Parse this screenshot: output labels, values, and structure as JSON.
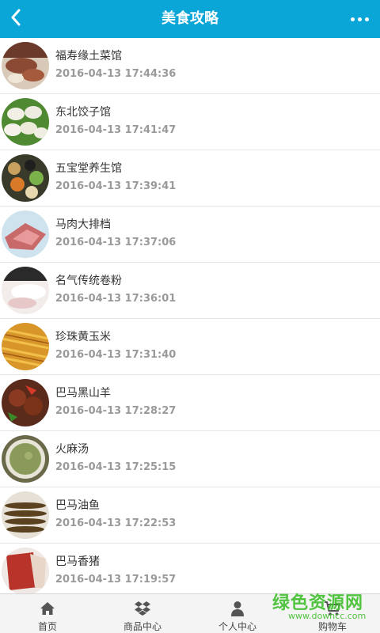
{
  "header": {
    "title": "美食攻略",
    "back_icon": "chevron-left-icon",
    "more_icon": "more-dots-icon",
    "color": "#0aa6d8"
  },
  "list": {
    "items": [
      {
        "name": "福寿缘土菜馆",
        "time": "2016-04-13 17:44:36"
      },
      {
        "name": "东北饺子馆",
        "time": "2016-04-13 17:41:47"
      },
      {
        "name": "五宝堂养生馆",
        "time": "2016-04-13 17:39:41"
      },
      {
        "name": "马肉大排档",
        "time": "2016-04-13 17:37:06"
      },
      {
        "name": "名气传统卷粉",
        "time": "2016-04-13 17:36:01"
      },
      {
        "name": "珍珠黄玉米",
        "time": "2016-04-13 17:31:40"
      },
      {
        "name": "巴马黑山羊",
        "time": "2016-04-13 17:28:27"
      },
      {
        "name": "火麻汤",
        "time": "2016-04-13 17:25:15"
      },
      {
        "name": "巴马油鱼",
        "time": "2016-04-13 17:22:53"
      },
      {
        "name": "巴马香猪",
        "time": "2016-04-13 17:19:57"
      }
    ]
  },
  "tabbar": {
    "tabs": [
      {
        "label": "首页",
        "icon": "home-icon"
      },
      {
        "label": "商品中心",
        "icon": "dropbox-icon"
      },
      {
        "label": "个人中心",
        "icon": "user-icon"
      },
      {
        "label": "购物车",
        "icon": "cart-icon"
      }
    ]
  },
  "watermark": {
    "text": "绿色资源网",
    "url": "www.downcc.com",
    "color": "#3fbf2c"
  }
}
